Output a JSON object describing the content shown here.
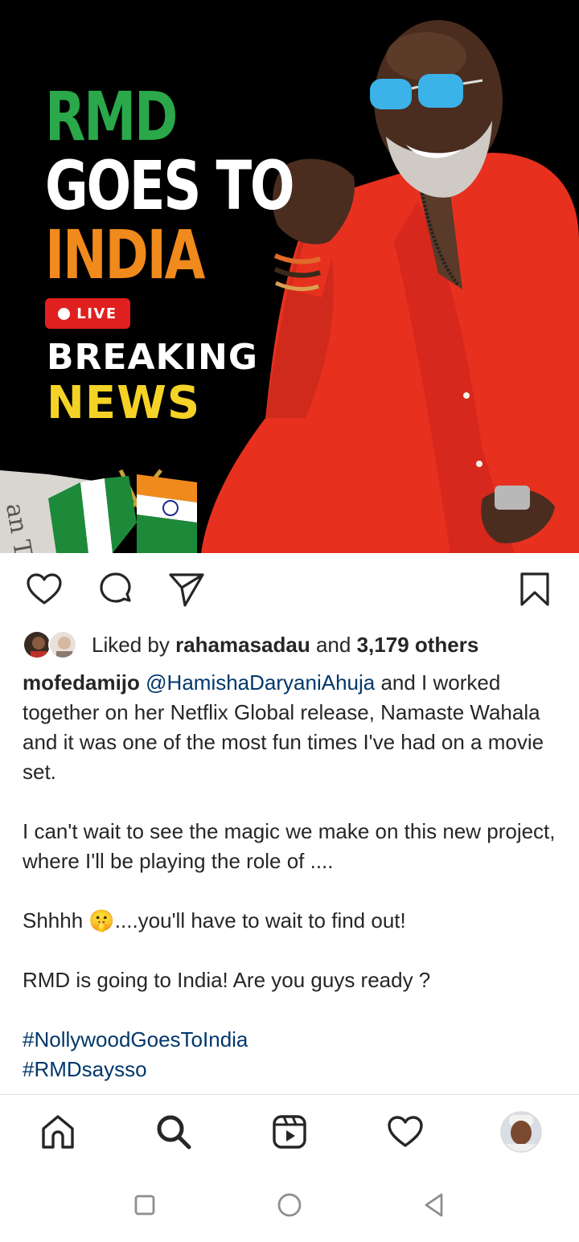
{
  "post_image": {
    "headline": [
      "RMD",
      "GOES TO",
      "INDIA"
    ],
    "live_label": "LIVE",
    "breaking": "BREAKING",
    "news": "NEWS",
    "colors": {
      "green": "#2aa84a",
      "orange": "#f08a1c",
      "yellow": "#f5d326",
      "live_red": "#e0201f",
      "shirt_red": "#e8301f"
    }
  },
  "actions": {
    "like_icon": "heart-icon",
    "comment_icon": "comment-icon",
    "share_icon": "send-icon",
    "save_icon": "bookmark-icon"
  },
  "likes": {
    "prefix": "Liked by",
    "user": "rahamasadau",
    "middle": "and",
    "count": "3,179 others"
  },
  "caption": {
    "username": "mofedamijo",
    "mention": "@HamishaDaryaniAhuja",
    "p1_rest": " and I worked together on her Netflix Global release, Namaste Wahala and it was one of the most fun times I've had on a movie set.",
    "p2": "I can't wait to see the magic we make on this new project, where I'll be playing the role of ....",
    "p3_start": "Shhhh ",
    "p3_emoji": "🤫",
    "p3_end": "....you'll have to wait to find out!",
    "p4": "RMD is going to India! Are you guys ready ?",
    "hashtags": [
      "#NollywoodGoesToIndia",
      "#RMDsaysso"
    ]
  },
  "bottom_nav": [
    "home-icon",
    "search-icon",
    "reels-icon",
    "activity-heart-icon",
    "profile-avatar"
  ],
  "system_nav": [
    "recents-square-icon",
    "home-circle-icon",
    "back-triangle-icon"
  ]
}
